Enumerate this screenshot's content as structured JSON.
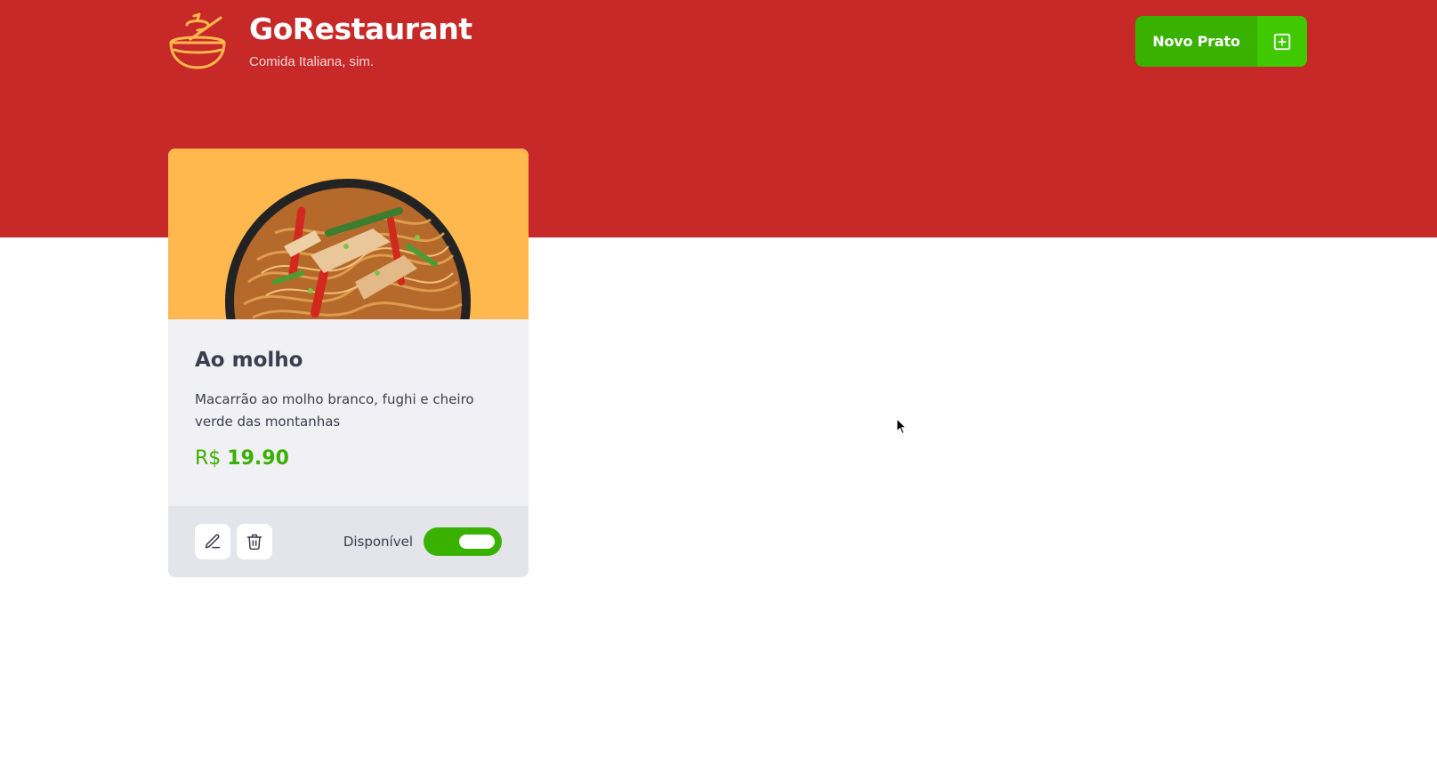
{
  "header": {
    "brand_title": "GoRestaurant",
    "brand_subtitle": "Comida Italiana, sim.",
    "logo_icon": "bowl-icon",
    "new_button_label": "Novo Prato",
    "new_button_icon": "plus-square-icon"
  },
  "colors": {
    "header_bg": "#c72828",
    "button_green": "#39b100",
    "button_icon_green": "#41c900",
    "card_image_bg": "#ffb84d",
    "card_bg": "#f0f0f5",
    "card_footer_bg": "#e4e4eb",
    "price_green": "#39b100"
  },
  "food": {
    "name": "Ao molho",
    "description": "Macarrão ao molho branco, fughi e cheiro verde das montanhas",
    "currency": "R$",
    "price": "19.90",
    "availability_label": "Disponível",
    "available": true
  },
  "actions": {
    "edit_icon": "pencil-icon",
    "delete_icon": "trash-icon"
  }
}
